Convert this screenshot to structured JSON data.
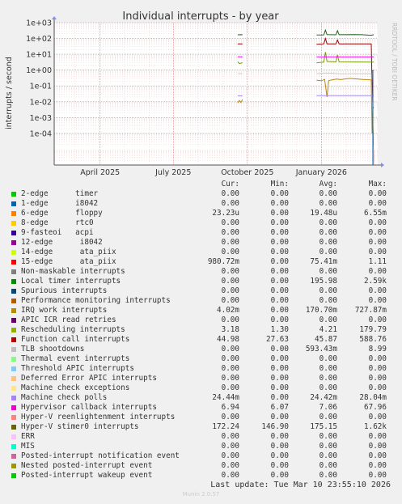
{
  "chart_data": {
    "type": "line",
    "title": "Individual interrupts - by year",
    "ylabel": "interrupts / second",
    "yscale": "log",
    "ylim": [
      1e-06,
      1000
    ],
    "y_ticks": [
      {
        "v": 1000,
        "label": "1e+03"
      },
      {
        "v": 100,
        "label": "1e+02"
      },
      {
        "v": 10,
        "label": "1e+01"
      },
      {
        "v": 1,
        "label": "1e+00"
      },
      {
        "v": 0.1,
        "label": "1e-01"
      },
      {
        "v": 0.01,
        "label": "1e-02"
      },
      {
        "v": 0.001,
        "label": "1e-03"
      },
      {
        "v": 0.0001,
        "label": "1e-04"
      }
    ],
    "xlim": [
      "2025-02-03",
      "2026-03-12"
    ],
    "x_ticks": [
      {
        "date": "2025-04-01",
        "label": "April 2025"
      },
      {
        "date": "2025-07-01",
        "label": "July 2025"
      },
      {
        "date": "2025-10-01",
        "label": "October 2025"
      },
      {
        "date": "2026-01-01",
        "label": "January 2026"
      }
    ],
    "grid": true,
    "side_label": "RRDTOOL / TOBI OETIKER",
    "series": [
      {
        "name": "Hyper-V stimer0 interrupts",
        "color": "#206020",
        "segments": [
          [
            [
              "2025-09-19",
              170
            ],
            [
              "2025-09-24",
              172
            ],
            [
              "2025-09-25",
              170
            ]
          ],
          [
            [
              "2025-12-26",
              165
            ],
            [
              "2026-01-04",
              168
            ],
            [
              "2026-01-06",
              340
            ],
            [
              "2026-01-08",
              175
            ],
            [
              "2026-01-19",
              170
            ],
            [
              "2026-01-21",
              310
            ],
            [
              "2026-01-23",
              172
            ],
            [
              "2026-02-12",
              178
            ],
            [
              "2026-02-20",
              172
            ],
            [
              "2026-03-04",
              160
            ],
            [
              "2026-03-07",
              172
            ]
          ]
        ]
      },
      {
        "name": "Function call interrupts",
        "color": "#a00000",
        "segments": [
          [
            [
              "2025-09-19",
              45
            ],
            [
              "2025-09-24",
              46
            ],
            [
              "2025-09-25",
              45
            ]
          ],
          [
            [
              "2025-12-26",
              43
            ],
            [
              "2026-01-04",
              46
            ],
            [
              "2026-01-06",
              100
            ],
            [
              "2026-01-08",
              46
            ],
            [
              "2026-01-19",
              45
            ],
            [
              "2026-01-21",
              80
            ],
            [
              "2026-01-23",
              45
            ],
            [
              "2026-03-04",
              45
            ],
            [
              "2026-03-07",
              1e-06
            ]
          ]
        ]
      },
      {
        "name": "Rescheduling interrupts",
        "color": "#7a9a10",
        "segments": [
          [
            [
              "2025-09-19",
              3.4
            ],
            [
              "2025-09-21",
              2.6
            ],
            [
              "2025-09-25",
              2.9
            ]
          ],
          [
            [
              "2025-12-26",
              2.9
            ],
            [
              "2026-01-04",
              3.2
            ],
            [
              "2026-01-06",
              14
            ],
            [
              "2026-01-08",
              3.5
            ],
            [
              "2026-01-19",
              3.3
            ],
            [
              "2026-01-21",
              9
            ],
            [
              "2026-01-23",
              3.3
            ],
            [
              "2026-03-04",
              3.2
            ],
            [
              "2026-03-07",
              3.18
            ]
          ]
        ]
      },
      {
        "name": "Hypervisor callback interrupts",
        "color": "#ff00ff",
        "segments": [
          [
            [
              "2025-09-19",
              7.0
            ],
            [
              "2025-09-25",
              6.9
            ]
          ],
          [
            [
              "2025-12-26",
              6.9
            ],
            [
              "2026-03-07",
              6.94
            ]
          ]
        ]
      },
      {
        "name": "15-edge ata_piix",
        "color": "#ff0000",
        "segments": [
          [
            [
              "2026-03-05",
              0.9
            ],
            [
              "2026-03-07",
              0.98
            ]
          ]
        ]
      },
      {
        "name": "TLB shootdowns",
        "color": "#cccccc",
        "segments": [
          [
            [
              "2025-09-19",
              0.6
            ],
            [
              "2025-09-25",
              0.6
            ]
          ],
          [
            [
              "2025-12-26",
              0.6
            ],
            [
              "2026-01-10",
              0.65
            ],
            [
              "2026-01-25",
              0.58
            ],
            [
              "2026-03-04",
              0.6
            ],
            [
              "2026-03-07",
              1e-06
            ]
          ]
        ]
      },
      {
        "name": "IRQ work interrupts",
        "color": "#b8860b",
        "segments": [
          [
            [
              "2025-09-19",
              0.0085
            ],
            [
              "2025-09-21",
              0.012
            ],
            [
              "2025-09-23",
              0.009
            ],
            [
              "2025-09-25",
              0.014
            ]
          ],
          [
            [
              "2025-12-26",
              0.23
            ],
            [
              "2026-01-01",
              0.21
            ],
            [
              "2026-01-05",
              0.26
            ],
            [
              "2026-01-08",
              0.02
            ],
            [
              "2026-01-10",
              0.22
            ],
            [
              "2026-01-20",
              0.27
            ],
            [
              "2026-01-25",
              0.25
            ],
            [
              "2026-02-05",
              0.3
            ],
            [
              "2026-02-20",
              0.26
            ],
            [
              "2026-03-04",
              0.24
            ],
            [
              "2026-03-05",
              0.0001
            ],
            [
              "2026-03-06",
              0.005
            ],
            [
              "2026-03-07",
              0.004
            ]
          ]
        ]
      },
      {
        "name": "Machine check polls",
        "color": "#a08cf0",
        "segments": [
          [
            [
              "2025-09-19",
              0.0235
            ],
            [
              "2025-09-25",
              0.0235
            ]
          ],
          [
            [
              "2025-12-26",
              0.0244
            ],
            [
              "2026-03-07",
              0.0244
            ]
          ]
        ]
      },
      {
        "name": "Local timer interrupts",
        "color": "#0066b3",
        "segments": [
          [
            [
              "2026-03-06",
              1e-06
            ],
            [
              "2026-03-06",
              1.0
            ]
          ]
        ]
      }
    ]
  },
  "legend": {
    "headers": [
      "Cur:",
      "Min:",
      "Avg:",
      "Max:"
    ],
    "rows": [
      {
        "label": "2-edge      timer",
        "color": "#00cc00",
        "cur": "0.00",
        "min": "0.00",
        "avg": "0.00",
        "max": "0.00"
      },
      {
        "label": "1-edge      i8042",
        "color": "#0066b3",
        "cur": "0.00",
        "min": "0.00",
        "avg": "0.00",
        "max": "0.00"
      },
      {
        "label": "6-edge      floppy",
        "color": "#ff8000",
        "cur": "23.23u",
        "min": "0.00",
        "avg": "19.48u",
        "max": "6.55m"
      },
      {
        "label": "8-edge      rtc0",
        "color": "#ffcc00",
        "cur": "0.00",
        "min": "0.00",
        "avg": "0.00",
        "max": "0.00"
      },
      {
        "label": "9-fasteoi   acpi",
        "color": "#330099",
        "cur": "0.00",
        "min": "0.00",
        "avg": "0.00",
        "max": "0.00"
      },
      {
        "label": "12-edge      i8042",
        "color": "#990099",
        "cur": "0.00",
        "min": "0.00",
        "avg": "0.00",
        "max": "0.00"
      },
      {
        "label": "14-edge      ata_piix",
        "color": "#ccff00",
        "cur": "0.00",
        "min": "0.00",
        "avg": "0.00",
        "max": "0.00"
      },
      {
        "label": "15-edge      ata_piix",
        "color": "#ff0000",
        "cur": "980.72m",
        "min": "0.00",
        "avg": "75.41m",
        "max": "1.11"
      },
      {
        "label": "Non-maskable interrupts",
        "color": "#808080",
        "cur": "0.00",
        "min": "0.00",
        "avg": "0.00",
        "max": "0.00"
      },
      {
        "label": "Local timer interrupts",
        "color": "#008f00",
        "cur": "0.00",
        "min": "0.00",
        "avg": "195.98",
        "max": "2.59k"
      },
      {
        "label": "Spurious interrupts",
        "color": "#00487d",
        "cur": "0.00",
        "min": "0.00",
        "avg": "0.00",
        "max": "0.00"
      },
      {
        "label": "Performance monitoring interrupts",
        "color": "#b35a00",
        "cur": "0.00",
        "min": "0.00",
        "avg": "0.00",
        "max": "0.00"
      },
      {
        "label": "IRQ work interrupts",
        "color": "#b38f00",
        "cur": "4.02m",
        "min": "0.00",
        "avg": "170.70m",
        "max": "727.87m"
      },
      {
        "label": "APIC ICR read retries",
        "color": "#6b006b",
        "cur": "0.00",
        "min": "0.00",
        "avg": "0.00",
        "max": "0.00"
      },
      {
        "label": "Rescheduling interrupts",
        "color": "#8fb300",
        "cur": "3.18",
        "min": "1.30",
        "avg": "4.21",
        "max": "179.79"
      },
      {
        "label": "Function call interrupts",
        "color": "#b30000",
        "cur": "44.98",
        "min": "27.63",
        "avg": "45.87",
        "max": "588.76"
      },
      {
        "label": "TLB shootdowns",
        "color": "#bebebe",
        "cur": "0.00",
        "min": "0.00",
        "avg": "593.43m",
        "max": "8.99"
      },
      {
        "label": "Thermal event interrupts",
        "color": "#80ff80",
        "cur": "0.00",
        "min": "0.00",
        "avg": "0.00",
        "max": "0.00"
      },
      {
        "label": "Threshold APIC interrupts",
        "color": "#80c9ff",
        "cur": "0.00",
        "min": "0.00",
        "avg": "0.00",
        "max": "0.00"
      },
      {
        "label": "Deferred Error APIC interrupts",
        "color": "#ffc080",
        "cur": "0.00",
        "min": "0.00",
        "avg": "0.00",
        "max": "0.00"
      },
      {
        "label": "Machine check exceptions",
        "color": "#ffe680",
        "cur": "0.00",
        "min": "0.00",
        "avg": "0.00",
        "max": "0.00"
      },
      {
        "label": "Machine check polls",
        "color": "#aa80ff",
        "cur": "24.44m",
        "min": "0.00",
        "avg": "24.42m",
        "max": "28.04m"
      },
      {
        "label": "Hypervisor callback interrupts",
        "color": "#ee00cc",
        "cur": "6.94",
        "min": "6.07",
        "avg": "7.06",
        "max": "67.96"
      },
      {
        "label": "Hyper-V reenlightenment interrupts",
        "color": "#ff8080",
        "cur": "0.00",
        "min": "0.00",
        "avg": "0.00",
        "max": "0.00"
      },
      {
        "label": "Hyper-V stimer0 interrupts",
        "color": "#666600",
        "cur": "172.24",
        "min": "146.90",
        "avg": "175.15",
        "max": "1.62k"
      },
      {
        "label": "ERR",
        "color": "#ffbfff",
        "cur": "0.00",
        "min": "0.00",
        "avg": "0.00",
        "max": "0.00"
      },
      {
        "label": "MIS",
        "color": "#00ffcc",
        "cur": "0.00",
        "min": "0.00",
        "avg": "0.00",
        "max": "0.00"
      },
      {
        "label": "Posted-interrupt notification event",
        "color": "#cc6699",
        "cur": "0.00",
        "min": "0.00",
        "avg": "0.00",
        "max": "0.00"
      },
      {
        "label": "Nested posted-interrupt event",
        "color": "#999900",
        "cur": "0.00",
        "min": "0.00",
        "avg": "0.00",
        "max": "0.00"
      },
      {
        "label": "Posted-interrupt wakeup event",
        "color": "#00cc00",
        "cur": "0.00",
        "min": "0.00",
        "avg": "0.00",
        "max": "0.00"
      }
    ]
  },
  "footer": {
    "last_update": "Last update: Tue Mar 10 23:55:10 2026",
    "version": "Munin 2.0.57"
  }
}
